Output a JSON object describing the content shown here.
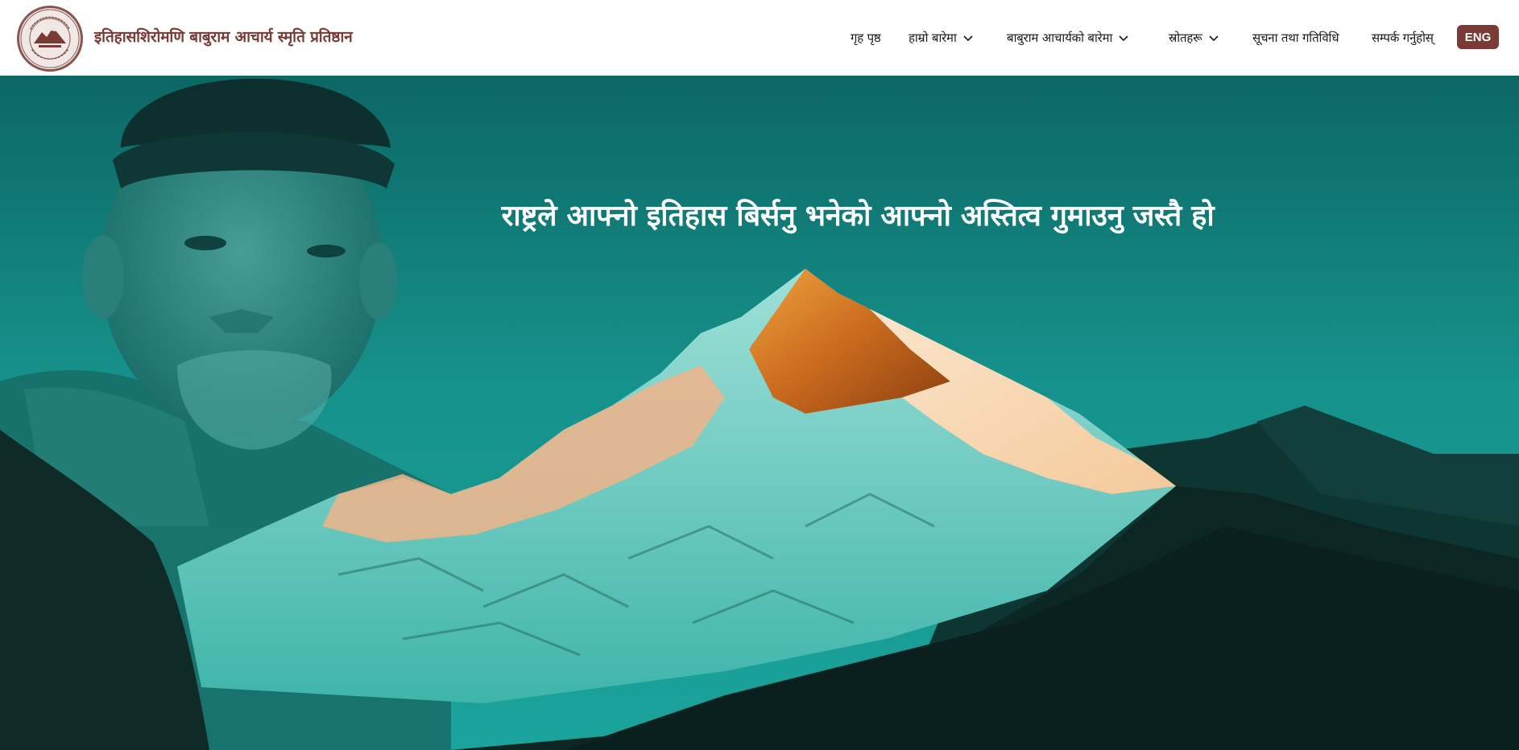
{
  "header": {
    "brand_title": "इतिहासशिरोमणि बाबुराम आचार्य स्मृति प्रतिष्ठान",
    "logo_icon": "organization-seal-logo",
    "nav": [
      {
        "label": "गृह पृष्ठ",
        "has_dropdown": false
      },
      {
        "label": "हाम्रो बारेमा",
        "has_dropdown": true
      },
      {
        "label": "बाबुराम आचार्यको बारेमा",
        "has_dropdown": true
      },
      {
        "label": "स्रोतहरू",
        "has_dropdown": true
      },
      {
        "label": "सूचना तथा गतिविधि",
        "has_dropdown": false
      },
      {
        "label": "सम्पर्क गर्नुहोस्",
        "has_dropdown": false
      }
    ],
    "language_button": "ENG"
  },
  "hero": {
    "quote": "राष्ट्रले आफ्नो इतिहास बिर्सनु भनेको आफ्नो अस्तित्व गुमाउनु जस्तै हो",
    "background": "teal-tinted portrait with mountain peak at sunrise"
  },
  "colors": {
    "brand": "#7a3a36",
    "hero_teal": "#138c86",
    "peak_orange": "#d9832a",
    "text_dark": "#1a1a1a"
  }
}
